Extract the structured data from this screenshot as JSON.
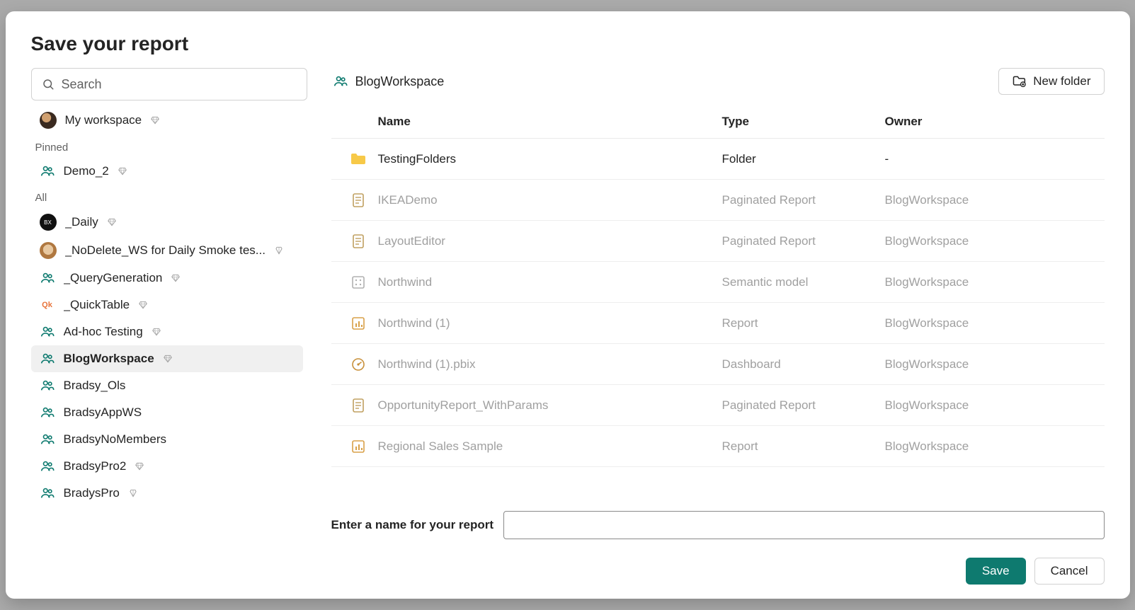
{
  "dialog": {
    "title": "Save your report",
    "search_placeholder": "Search",
    "name_field_label": "Enter a name for your report",
    "name_field_value": "",
    "save_label": "Save",
    "cancel_label": "Cancel",
    "new_folder_label": "New folder"
  },
  "breadcrumb": {
    "workspace_name": "BlogWorkspace"
  },
  "sidebar": {
    "my_workspace_label": "My workspace",
    "section_pinned": "Pinned",
    "section_all": "All",
    "pinned": [
      {
        "label": "Demo_2",
        "icon": "group",
        "badge": "diamond"
      }
    ],
    "all": [
      {
        "label": "_Daily",
        "icon": "avatar-black",
        "badge": "diamond"
      },
      {
        "label": "_NoDelete_WS for Daily Smoke tes...",
        "icon": "avatar-dog",
        "badge": "premium"
      },
      {
        "label": "_QueryGeneration",
        "icon": "group",
        "badge": "diamond"
      },
      {
        "label": "_QuickTable",
        "icon": "quick",
        "badge": "diamond"
      },
      {
        "label": "Ad-hoc Testing",
        "icon": "group",
        "badge": "diamond"
      },
      {
        "label": "BlogWorkspace",
        "icon": "group",
        "badge": "diamond",
        "selected": true
      },
      {
        "label": "Bradsy_Ols",
        "icon": "group",
        "badge": null
      },
      {
        "label": "BradsyAppWS",
        "icon": "group",
        "badge": null
      },
      {
        "label": "BradsyNoMembers",
        "icon": "group",
        "badge": null
      },
      {
        "label": "BradsyPro2",
        "icon": "group",
        "badge": "diamond"
      },
      {
        "label": "BradysPro",
        "icon": "group",
        "badge": "premium"
      }
    ]
  },
  "table": {
    "columns": {
      "name": "Name",
      "type": "Type",
      "owner": "Owner"
    },
    "rows": [
      {
        "name": "TestingFolders",
        "type": "Folder",
        "owner": "-",
        "icon": "folder",
        "disabled": false
      },
      {
        "name": "IKEADemo",
        "type": "Paginated Report",
        "owner": "BlogWorkspace",
        "icon": "paginated",
        "disabled": true
      },
      {
        "name": "LayoutEditor",
        "type": "Paginated Report",
        "owner": "BlogWorkspace",
        "icon": "paginated",
        "disabled": true
      },
      {
        "name": "Northwind",
        "type": "Semantic model",
        "owner": "BlogWorkspace",
        "icon": "model",
        "disabled": true
      },
      {
        "name": "Northwind (1)",
        "type": "Report",
        "owner": "BlogWorkspace",
        "icon": "report",
        "disabled": true
      },
      {
        "name": "Northwind (1).pbix",
        "type": "Dashboard",
        "owner": "BlogWorkspace",
        "icon": "dashboard",
        "disabled": true
      },
      {
        "name": "OpportunityReport_WithParams",
        "type": "Paginated Report",
        "owner": "BlogWorkspace",
        "icon": "paginated",
        "disabled": true
      },
      {
        "name": "Regional Sales Sample",
        "type": "Report",
        "owner": "BlogWorkspace",
        "icon": "report",
        "disabled": true
      }
    ]
  }
}
